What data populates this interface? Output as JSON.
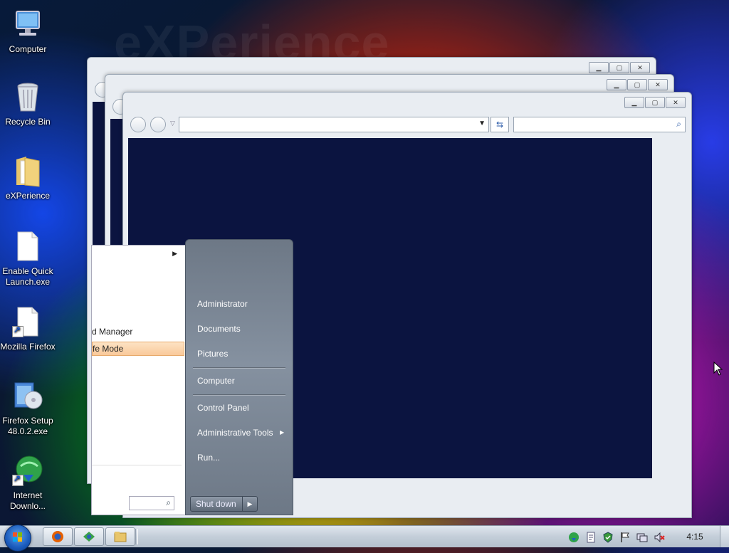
{
  "watermark": "eXPerience",
  "desktop_icons": [
    {
      "label": "Computer",
      "icon": "computer-icon"
    },
    {
      "label": "Recycle Bin",
      "icon": "recycle-bin-icon"
    },
    {
      "label": "eXPerience",
      "icon": "folder-icon"
    },
    {
      "label": "Enable Quick Launch.exe",
      "icon": "file-icon"
    },
    {
      "label": "Mozilla Firefox",
      "icon": "file-shortcut-icon"
    },
    {
      "label": "Firefox Setup 48.0.2.exe",
      "icon": "installer-icon"
    },
    {
      "label": "Internet Downlo...",
      "icon": "download-manager-icon"
    }
  ],
  "start_menu": {
    "left_items": {
      "partial_1": "d Manager",
      "partial_2": "fe Mode"
    },
    "right_items": [
      "Administrator",
      "Documents",
      "Pictures",
      "Computer",
      "Control Panel",
      "Administrative Tools",
      "Run..."
    ],
    "shutdown_label": "Shut down"
  },
  "taskbar": {
    "clock": "4:15",
    "pinned": [
      "firefox-icon",
      "network-icon",
      "explorer-icon"
    ],
    "tray": [
      "idm-tray-icon",
      "document-tray-icon",
      "security-tray-icon",
      "flag-icon",
      "network-tray-icon",
      "volume-muted-icon"
    ]
  },
  "colors": {
    "start_menu_right": "#7a8594",
    "taskbar": "#c4ced9",
    "window_frame": "#e9edf2"
  }
}
